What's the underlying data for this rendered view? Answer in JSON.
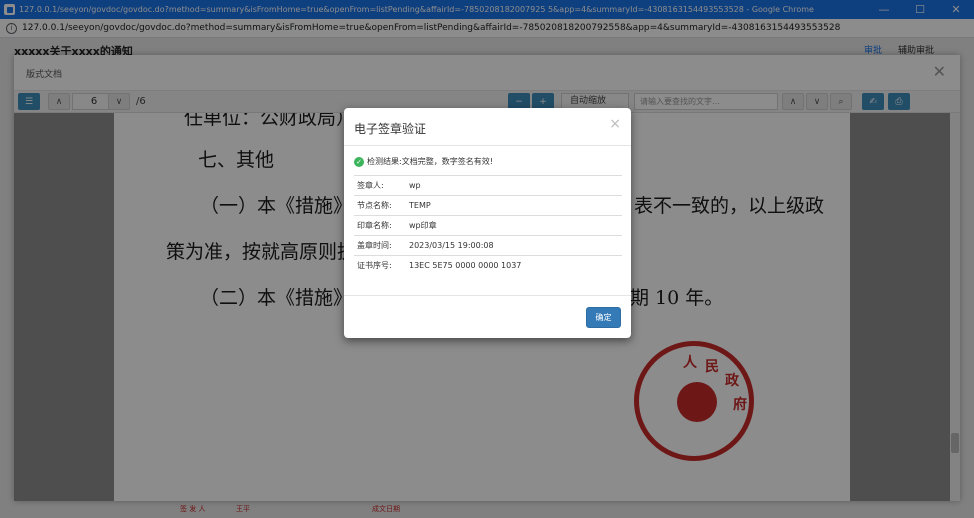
{
  "browser": {
    "window_title": "127.0.0.1/seeyon/govdoc/govdoc.do?method=summary&isFromHome=true&openFrom=listPending&affairId=-7850208182007925 5&app=4&summaryId=-4308163154493553528 - Google Chrome",
    "url": "127.0.0.1/seeyon/govdoc/govdoc.do?method=summary&isFromHome=true&openFrom=listPending&affairId=-785020818200792558&app=4&summaryId=-4308163154493553528",
    "minimize": "—",
    "maximize": "☐",
    "close": "✕"
  },
  "page": {
    "title": "xxxxx关于xxxx的通知",
    "tabs": [
      "审批",
      "辅助审批"
    ]
  },
  "viewer": {
    "title": "版式文档",
    "page_number": "6",
    "page_total": "/6",
    "zoom": "自动缩放",
    "search_placeholder": "请输入要查找的文字...",
    "document_lines": [
      "任单位：公财政局）",
      "七、其他",
      "（一）本《措施》",
      "表不一致的，以上级政",
      "策为准，按就高原则执",
      "（二）本《措施》",
      "期 10 年。"
    ],
    "seal_text": [
      "人",
      "民",
      "政",
      "府"
    ],
    "footer": [
      "签 发 人",
      "王平",
      "成文日期"
    ]
  },
  "dialog": {
    "title": "电子签章验证",
    "result_label": "检测结果:",
    "result_text": "文档完整，数字签名有效!",
    "rows": [
      {
        "key": "签章人:",
        "value": "wp"
      },
      {
        "key": "节点名称:",
        "value": "TEMP"
      },
      {
        "key": "印章名称:",
        "value": "wp印章"
      },
      {
        "key": "盖章时间:",
        "value": "2023/03/15 19:00:08"
      },
      {
        "key": "证书序号:",
        "value": "13EC 5E75 0000 0000 1037"
      }
    ],
    "confirm": "确定"
  }
}
